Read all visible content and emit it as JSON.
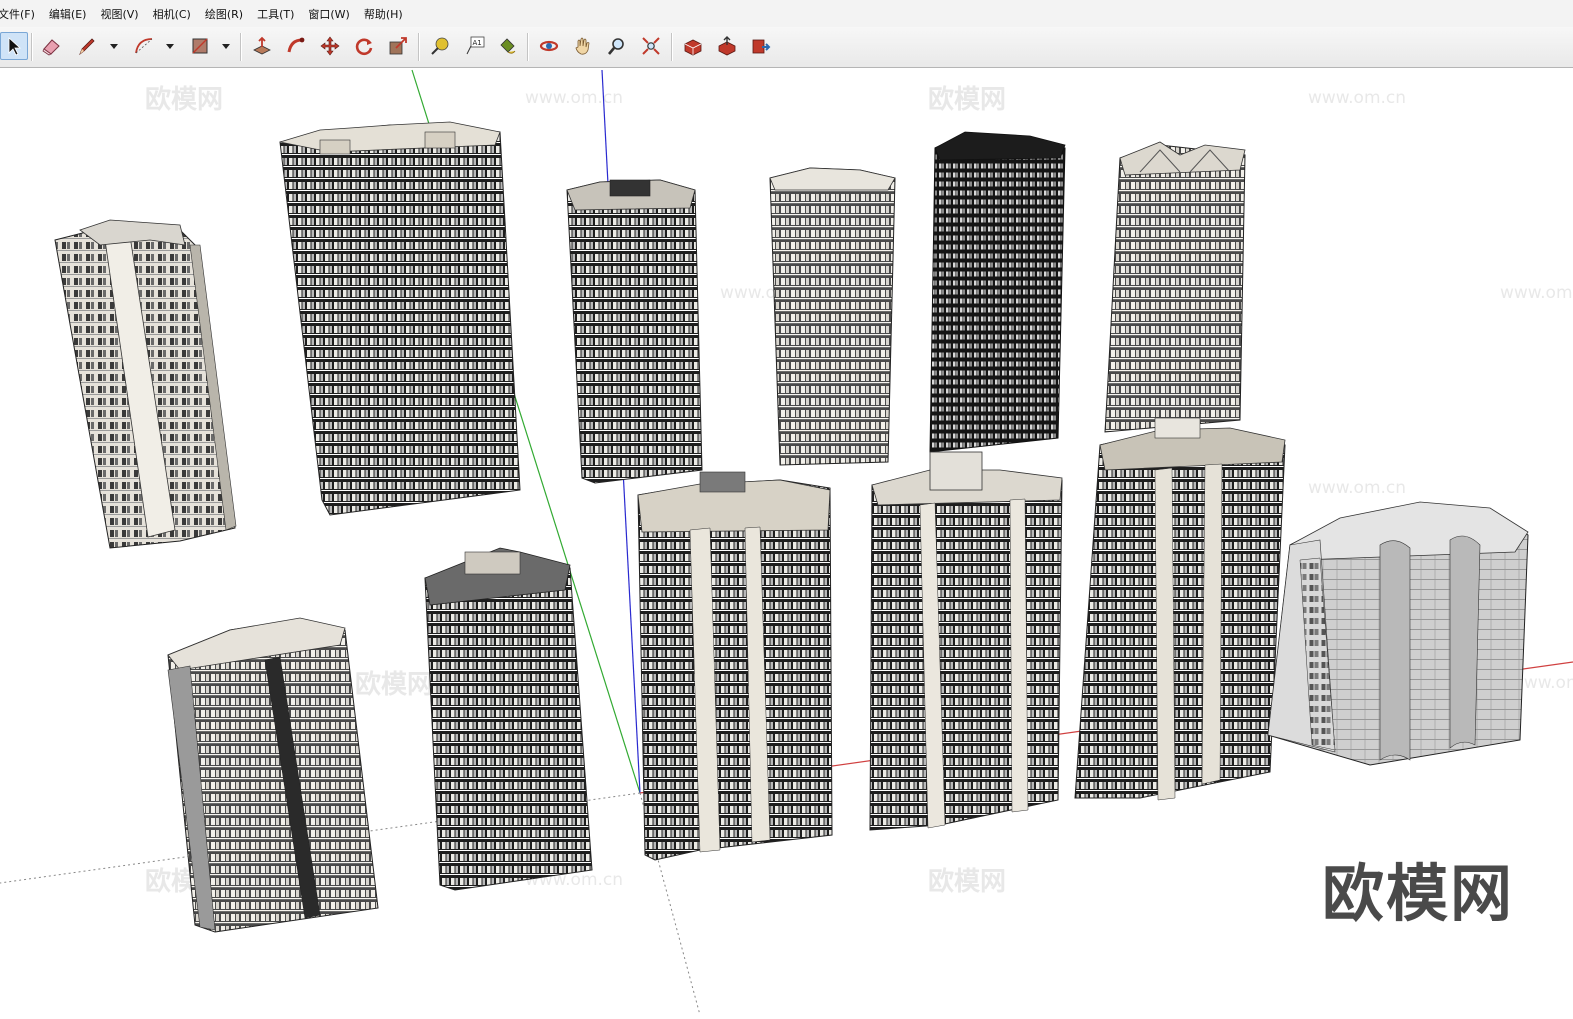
{
  "menu": {
    "items": [
      "文件(F)",
      "编辑(E)",
      "视图(V)",
      "相机(C)",
      "绘图(R)",
      "工具(T)",
      "窗口(W)",
      "帮助(H)"
    ]
  },
  "toolbar": {
    "tools": [
      {
        "name": "select-tool",
        "icon": "arrow-cursor-icon"
      },
      {
        "name": "eraser-tool",
        "icon": "eraser-icon"
      },
      {
        "name": "pencil-tool",
        "icon": "pencil-icon"
      },
      {
        "name": "arc-tool",
        "icon": "arc-icon"
      },
      {
        "name": "rectangle-tool",
        "icon": "rectangle-icon"
      },
      {
        "name": "push-pull-tool",
        "icon": "push-pull-icon"
      },
      {
        "name": "follow-me-tool",
        "icon": "follow-me-icon"
      },
      {
        "name": "move-tool",
        "icon": "move-icon"
      },
      {
        "name": "rotate-tool",
        "icon": "rotate-icon"
      },
      {
        "name": "scale-tool",
        "icon": "scale-icon"
      },
      {
        "name": "tape-measure-tool",
        "icon": "tape-measure-icon"
      },
      {
        "name": "text-tool",
        "icon": "text-icon"
      },
      {
        "name": "paint-bucket-tool",
        "icon": "paint-bucket-icon"
      },
      {
        "name": "orbit-tool",
        "icon": "orbit-icon"
      },
      {
        "name": "pan-tool",
        "icon": "pan-hand-icon"
      },
      {
        "name": "zoom-tool",
        "icon": "zoom-icon"
      },
      {
        "name": "zoom-extents-tool",
        "icon": "zoom-extents-icon"
      },
      {
        "name": "warehouse-tool",
        "icon": "3d-warehouse-icon"
      },
      {
        "name": "share-model-tool",
        "icon": "share-model-icon"
      },
      {
        "name": "extension-tool",
        "icon": "extension-icon"
      }
    ],
    "text_tool_label": "A1"
  },
  "scene": {
    "colors": {
      "background": "#ffffff",
      "green_axis": "#33aa33",
      "blue_axis": "#2a2ad0",
      "red_axis": "#d04040",
      "building_dark": "#2b2b2b",
      "building_light": "#e6e2da",
      "building_mid": "#8c8c8c"
    },
    "watermark_large": "欧模网",
    "watermark_faint": "欧模网",
    "watermark_url": "www.om.cn",
    "buildings": [
      {
        "id": "tower-1",
        "style": "light"
      },
      {
        "id": "tower-2",
        "style": "dark"
      },
      {
        "id": "tower-3",
        "style": "dark"
      },
      {
        "id": "tower-4",
        "style": "mid"
      },
      {
        "id": "tower-5",
        "style": "black"
      },
      {
        "id": "tower-6",
        "style": "mid"
      },
      {
        "id": "tower-7",
        "style": "mid"
      },
      {
        "id": "tower-8",
        "style": "dark"
      },
      {
        "id": "tower-9",
        "style": "dark"
      },
      {
        "id": "tower-10",
        "style": "dark"
      },
      {
        "id": "tower-11",
        "style": "dark"
      },
      {
        "id": "tower-12",
        "style": "light"
      }
    ]
  }
}
